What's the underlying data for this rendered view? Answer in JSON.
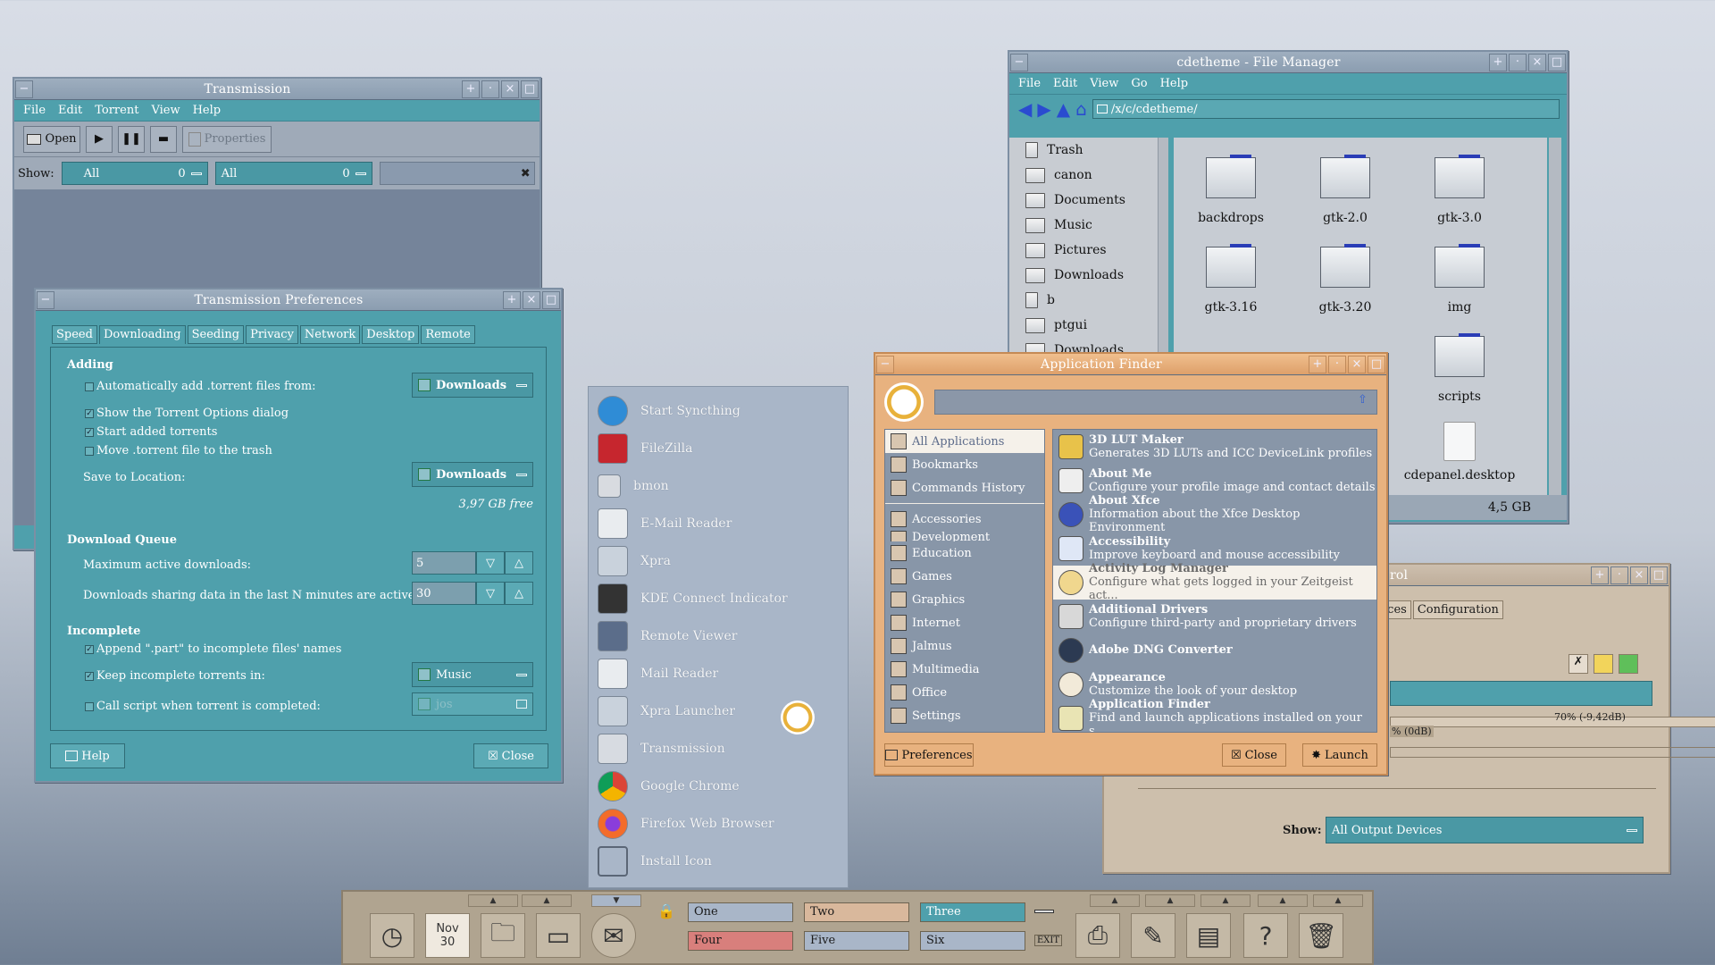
{
  "transmission": {
    "title": "Transmission",
    "menu": [
      "File",
      "Edit",
      "Torrent",
      "View",
      "Help"
    ],
    "toolbar": {
      "open": "Open",
      "properties": "Properties"
    },
    "filter": {
      "show_label": "Show:",
      "f1": "All",
      "f1_count": "0",
      "f2": "All",
      "f2_count": "0"
    }
  },
  "prefs": {
    "title": "Transmission Preferences",
    "tabs": [
      "Speed",
      "Downloading",
      "Seeding",
      "Privacy",
      "Network",
      "Desktop",
      "Remote"
    ],
    "adding_header": "Adding",
    "auto_add": "Automatically add .torrent files from:",
    "auto_add_folder": "Downloads",
    "show_options": "Show the Torrent Options dialog",
    "start_added": "Start added torrents",
    "move_trash": "Move .torrent file to the trash",
    "save_location": "Save to Location:",
    "save_folder": "Downloads",
    "free_space": "3,97 GB free",
    "queue_header": "Download Queue",
    "max_active": "Maximum active downloads:",
    "max_active_value": "5",
    "sharing": "Downloads sharing data in the last N minutes are active:",
    "sharing_value": "30",
    "incomplete_header": "Incomplete",
    "append_part": "Append \".part\" to incomplete files' names",
    "keep_incomplete": "Keep incomplete torrents in:",
    "keep_folder": "Music",
    "call_script": "Call script when torrent is completed:",
    "script_value": "jos",
    "help": "Help",
    "close": "Close"
  },
  "filemanager": {
    "title": "cdetheme - File Manager",
    "menu": [
      "File",
      "Edit",
      "View",
      "Go",
      "Help"
    ],
    "path": "/x/c/cdetheme/",
    "sidebar": [
      "Trash",
      "canon",
      "Documents",
      "Music",
      "Pictures",
      "Downloads",
      "b",
      "ptgui",
      "Downloads"
    ],
    "items": [
      "backdrops",
      "gtk-2.0",
      "gtk-3.0",
      "gtk-3.16",
      "gtk-3.20",
      "img",
      "scripts",
      "cdepanel.desktop"
    ],
    "status_free": "4,5 GB"
  },
  "launcher": {
    "items": [
      "Start Syncthing",
      "FileZilla",
      "bmon",
      "E-Mail Reader",
      "Xpra",
      "KDE Connect Indicator",
      "Remote Viewer",
      "Mail Reader",
      "Xpra Launcher",
      "Transmission",
      "Google Chrome",
      "Firefox Web Browser",
      "Install Icon"
    ]
  },
  "appfinder": {
    "title": "Application Finder",
    "search_value": "",
    "categories": [
      "All Applications",
      "Bookmarks",
      "Commands History",
      "Accessories",
      "Development",
      "Education",
      "Games",
      "Graphics",
      "Internet",
      "Jalmus",
      "Multimedia",
      "Office",
      "Settings"
    ],
    "apps": [
      {
        "name": "3D LUT Maker",
        "desc": "Generates 3D LUTs and ICC DeviceLink profiles"
      },
      {
        "name": "About Me",
        "desc": "Configure your profile image and contact details"
      },
      {
        "name": "About Xfce",
        "desc": "Information about the Xfce Desktop Environment"
      },
      {
        "name": "Accessibility",
        "desc": "Improve keyboard and mouse accessibility"
      },
      {
        "name": "Activity Log Manager",
        "desc": "Configure what gets logged in your Zeitgeist act..."
      },
      {
        "name": "Additional Drivers",
        "desc": "Configure third-party and proprietary drivers"
      },
      {
        "name": "Adobe DNG Converter",
        "desc": ""
      },
      {
        "name": "Appearance",
        "desc": "Customize the look of your desktop"
      },
      {
        "name": "Application Finder",
        "desc": "Find and launch applications installed on your s..."
      }
    ],
    "preferences": "Preferences",
    "close": "Close",
    "launch": "Launch"
  },
  "volume": {
    "title_fragment": "rol",
    "tabs": [
      "ices",
      "Configuration"
    ],
    "level_text": "70% (-9,42dB)",
    "zero_db": "% (0dB)",
    "show_label": "Show:",
    "show_value": "All Output Devices"
  },
  "panel": {
    "date_month": "Nov",
    "date_day": "30",
    "workspaces": [
      "One",
      "Two",
      "Three",
      "Four",
      "Five",
      "Six"
    ],
    "exit": "EXIT"
  },
  "colors": {
    "teal": "#4fa0ac",
    "orange": "#e8b27f",
    "beige": "#c9b89f",
    "panel": "#b0a490"
  }
}
